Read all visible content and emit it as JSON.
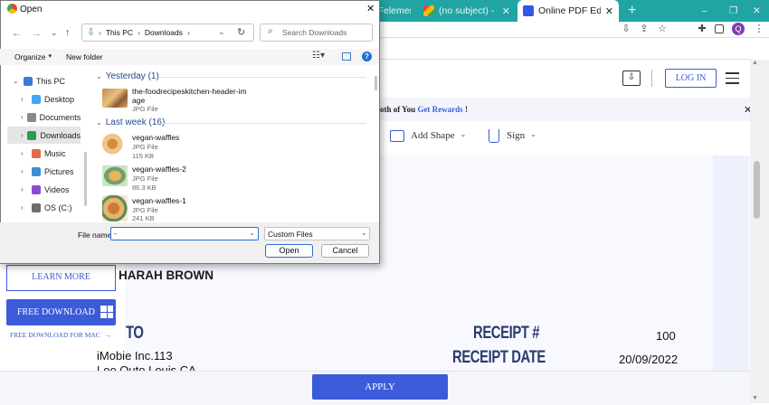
{
  "browser": {
    "tabs": [
      {
        "label": "PDFelement Blog"
      },
      {
        "label": "(no subject) - mayne"
      },
      {
        "label": "Online PDF Editor - Ed"
      }
    ],
    "new_tab": "+",
    "window_controls": {
      "minimize": "–",
      "maximize": "❐",
      "close": "✕"
    },
    "profile_initial": "Q"
  },
  "page": {
    "header": {
      "login": "LOG IN"
    },
    "banner": {
      "text": "oth of You ",
      "link": "Get Rewards",
      "suffix": " !",
      "close": "✕"
    },
    "tools": {
      "add_shape": "Add Shape",
      "sign": "Sign"
    },
    "promo": {
      "learn_more": "LEARN MORE",
      "free_download": "FREE DOWNLOAD",
      "free_download_mac": "FREE DOWNLOAD FOR MAC"
    },
    "receipt": {
      "name": "HARAH BROWN",
      "to_label": "TO",
      "receipt_no_label": "RECEIPT #",
      "receipt_no": "100",
      "receipt_date_label": "RECEIPT DATE",
      "receipt_date": "20/09/2022",
      "company": "iMobie Inc.113",
      "address_partial": "Loo Outo Louis CA"
    },
    "apply": "APPLY"
  },
  "dialog": {
    "title": "Open",
    "close": "✕",
    "path": [
      "This PC",
      "Downloads"
    ],
    "search_placeholder": "Search Downloads",
    "organize": "Organize",
    "new_folder": "New folder",
    "help": "?",
    "nav": [
      {
        "label": "This PC",
        "icon": "computer-icon",
        "color": "#3a7bd5"
      },
      {
        "label": "Desktop",
        "icon": "desktop-icon",
        "color": "#3fa9f5"
      },
      {
        "label": "Documents",
        "icon": "documents-icon",
        "color": "#8a8a8a"
      },
      {
        "label": "Downloads",
        "icon": "downloads-icon",
        "color": "#2e9b4f"
      },
      {
        "label": "Music",
        "icon": "music-icon",
        "color": "#e06b4b"
      },
      {
        "label": "Pictures",
        "icon": "pictures-icon",
        "color": "#3a8fd8"
      },
      {
        "label": "Videos",
        "icon": "videos-icon",
        "color": "#8a4bd1"
      },
      {
        "label": "OS (C:)",
        "icon": "drive-icon",
        "color": "#6e6e6e"
      }
    ],
    "groups": [
      {
        "label": "Yesterday (1)",
        "files": [
          {
            "name": "the-foodrecipeskitchen-header-im",
            "name2": "age",
            "type": "JPG File",
            "size": ""
          }
        ]
      },
      {
        "label": "Last week (16)",
        "files": [
          {
            "name": "vegan-waffles",
            "name2": "",
            "type": "JPG File",
            "size": "115 KB"
          },
          {
            "name": "vegan-waffles-2",
            "name2": "",
            "type": "JPG File",
            "size": "86.3 KB"
          },
          {
            "name": "vegan-waffles-1",
            "name2": "",
            "type": "JPG File",
            "size": "241 KB"
          }
        ]
      }
    ],
    "file_name_label": "File name:",
    "file_name_value": "-",
    "filter": "Custom Files",
    "open": "Open",
    "cancel": "Cancel"
  }
}
